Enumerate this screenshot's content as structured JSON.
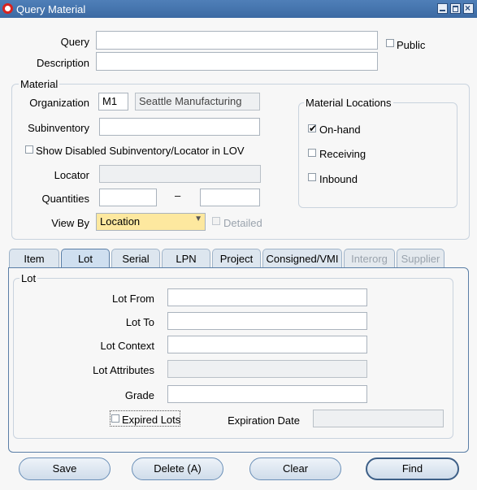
{
  "window": {
    "title": "Query Material"
  },
  "header": {
    "query_label": "Query",
    "query_value": "",
    "public_label": "Public",
    "description_label": "Description",
    "description_value": ""
  },
  "material": {
    "group_title": "Material",
    "organization_label": "Organization",
    "organization_code": "M1",
    "organization_name": "Seattle Manufacturing",
    "subinventory_label": "Subinventory",
    "subinventory_value": "",
    "show_disabled_label": "Show Disabled Subinventory/Locator in LOV",
    "locator_label": "Locator",
    "quantities_label": "Quantities",
    "quantities_from": "",
    "quantities_sep": "–",
    "quantities_to": "",
    "view_by_label": "View By",
    "view_by_value": "Location",
    "detailed_label": "Detailed"
  },
  "locations": {
    "group_title": "Material Locations",
    "onhand_label": "On-hand",
    "onhand_checked": true,
    "receiving_label": "Receiving",
    "inbound_label": "Inbound"
  },
  "tabs": [
    {
      "label": "Item"
    },
    {
      "label": "Lot"
    },
    {
      "label": "Serial"
    },
    {
      "label": "LPN"
    },
    {
      "label": "Project"
    },
    {
      "label": "Consigned/VMI"
    },
    {
      "label": "Interorg"
    },
    {
      "label": "Supplier"
    }
  ],
  "lot": {
    "group_title": "Lot",
    "lot_from_label": "Lot From",
    "lot_to_label": "Lot To",
    "lot_context_label": "Lot Context",
    "lot_attributes_label": "Lot Attributes",
    "grade_label": "Grade",
    "expired_lots_label": "Expired Lots",
    "expiration_date_label": "Expiration Date"
  },
  "buttons": {
    "save": "Save",
    "delete": "Delete (A)",
    "clear": "Clear",
    "find": "Find"
  },
  "colors": {
    "titlebar": "#3c6aa3",
    "required_field": "#fde89f"
  }
}
